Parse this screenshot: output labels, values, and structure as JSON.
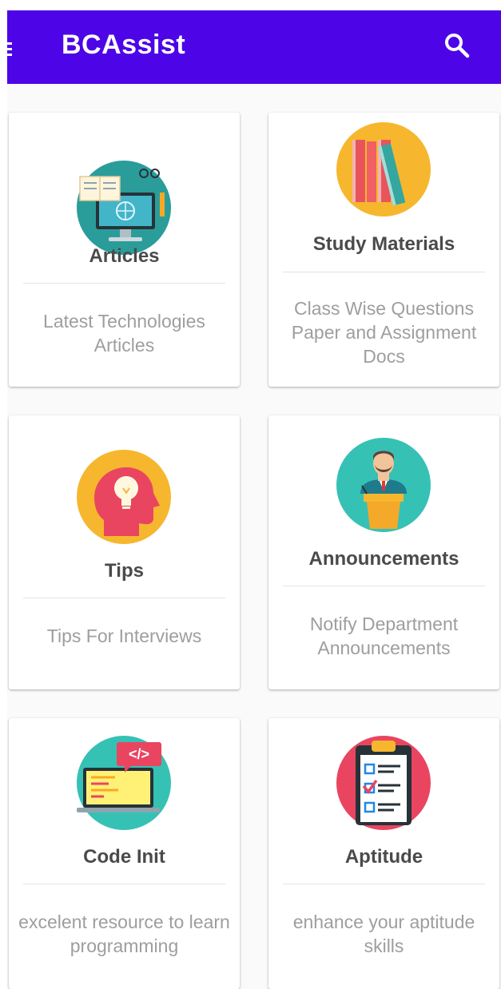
{
  "app": {
    "title": "BCAssist"
  },
  "colors": {
    "appbar": "#4d05e8",
    "background": "#fafafa",
    "card": "#ffffff"
  },
  "icons": {
    "menu": "menu-icon",
    "search": "search-icon"
  },
  "cards": [
    {
      "title": "Articles",
      "description": "Latest Technologies Articles",
      "icon": "computer-reading-icon"
    },
    {
      "title": "Study Materials",
      "description": "Class Wise Questions Paper and Assignment Docs",
      "icon": "books-icon"
    },
    {
      "title": "Tips",
      "description": "Tips For Interviews",
      "icon": "head-lightbulb-icon"
    },
    {
      "title": "Announcements",
      "description": "Notify Department Announcements",
      "icon": "speaker-podium-icon"
    },
    {
      "title": "Code Init",
      "description": "excelent resource to learn programming",
      "icon": "code-laptop-icon"
    },
    {
      "title": "Aptitude",
      "description": "enhance your aptitude skills",
      "icon": "checklist-clipboard-icon"
    }
  ]
}
